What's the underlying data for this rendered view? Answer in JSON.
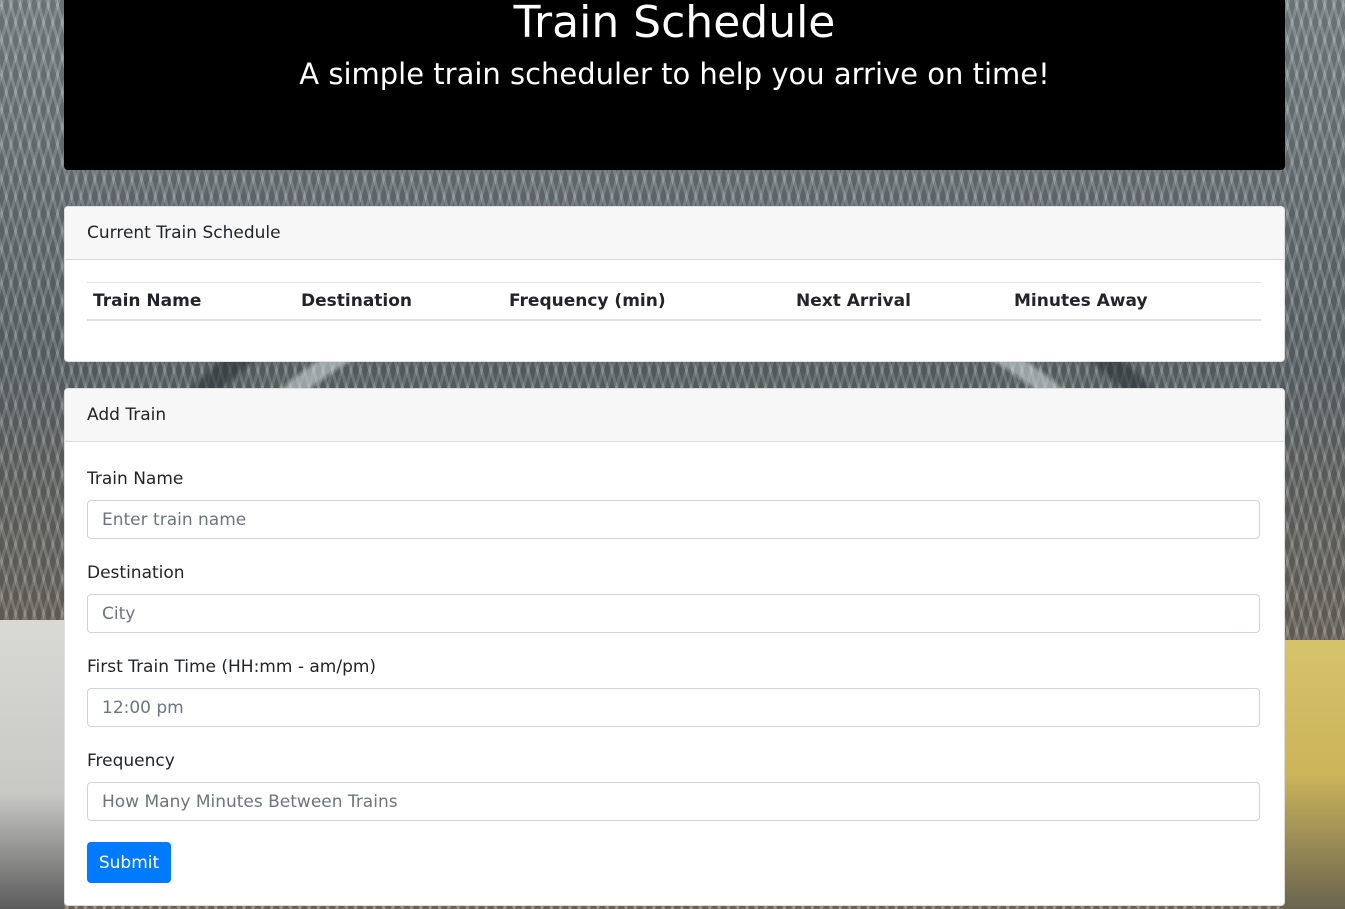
{
  "header": {
    "title": "Train Schedule",
    "subtitle": "A simple train scheduler to help you arrive on time!"
  },
  "schedule": {
    "heading": "Current Train Schedule",
    "columns": [
      "Train Name",
      "Destination",
      "Frequency (min)",
      "Next Arrival",
      "Minutes Away"
    ],
    "rows": []
  },
  "add_train": {
    "heading": "Add Train",
    "fields": {
      "train_name": {
        "label": "Train Name",
        "placeholder": "Enter train name",
        "value": ""
      },
      "destination": {
        "label": "Destination",
        "placeholder": "City",
        "value": ""
      },
      "first_time": {
        "label": "First Train Time (HH:mm - am/pm)",
        "placeholder": "12:00 pm",
        "value": ""
      },
      "frequency": {
        "label": "Frequency",
        "placeholder": "How Many Minutes Between Trains",
        "value": ""
      }
    },
    "submit_label": "Submit"
  },
  "colors": {
    "header_bg": "#000000",
    "primary": "#007bff",
    "card_header_bg": "#f7f7f7"
  }
}
